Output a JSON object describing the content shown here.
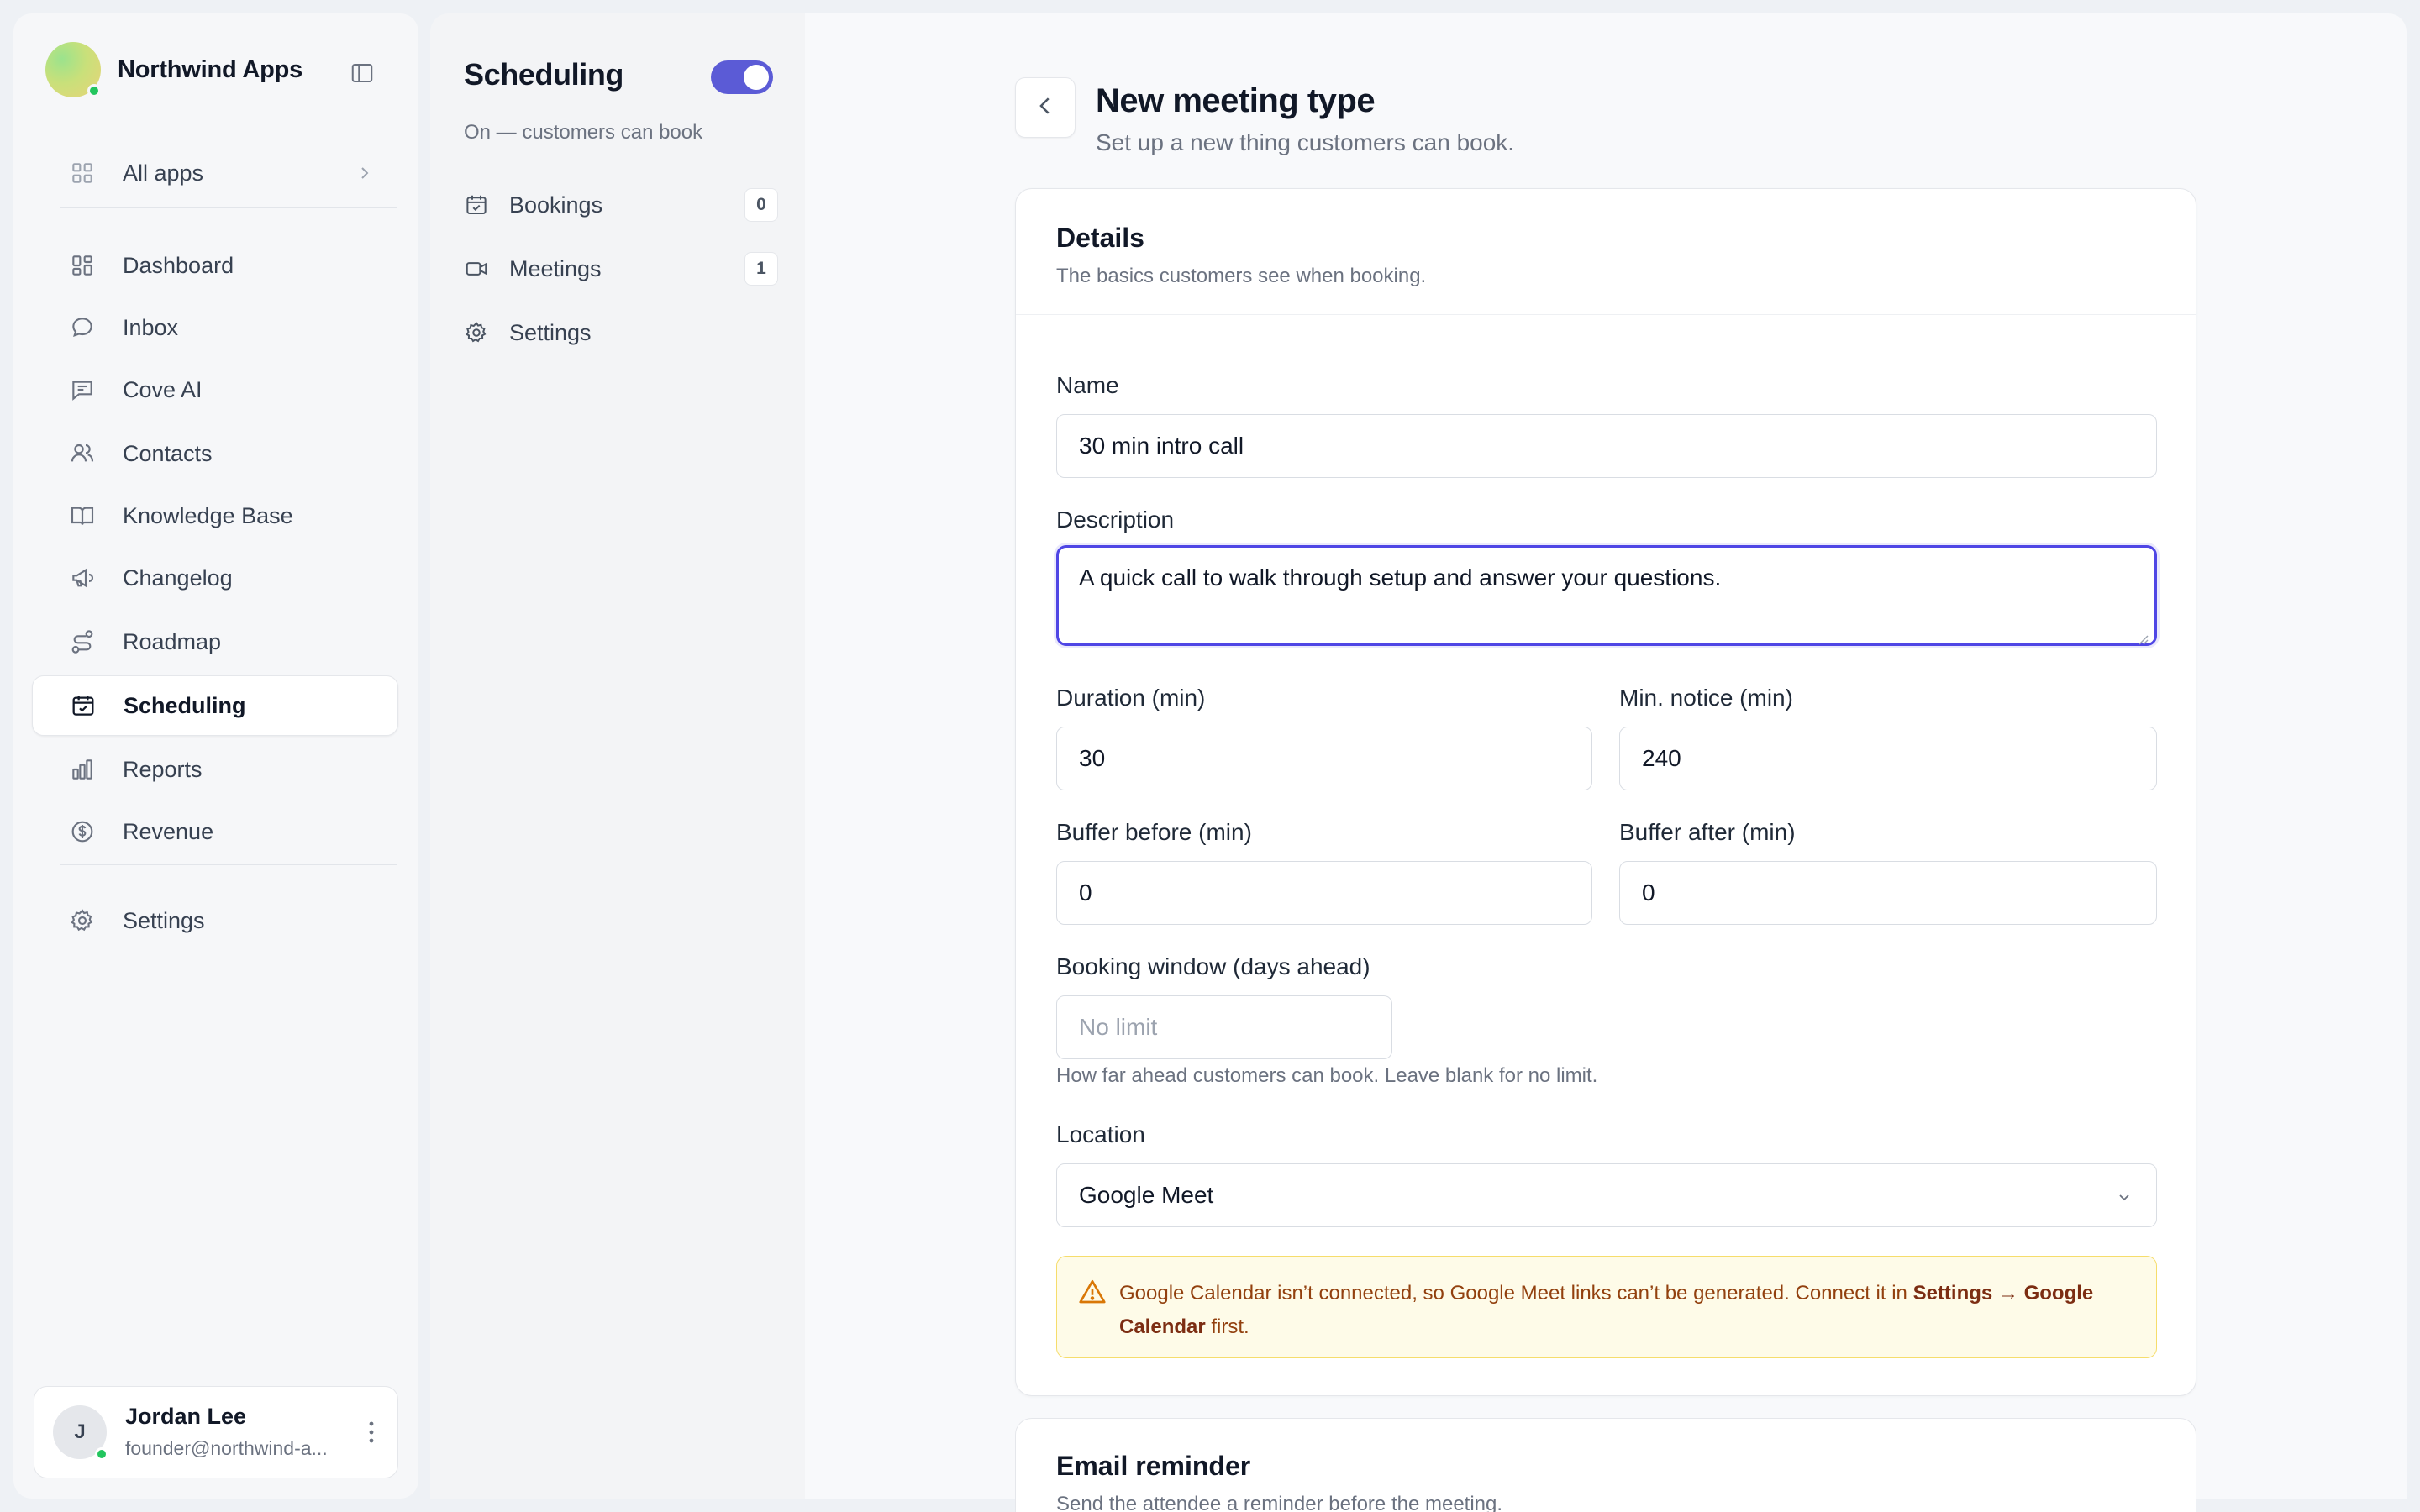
{
  "sidebar": {
    "brand": "Northwind Apps",
    "all_apps": "All apps",
    "items": [
      {
        "label": "Dashboard"
      },
      {
        "label": "Inbox"
      },
      {
        "label": "Cove AI"
      },
      {
        "label": "Contacts"
      },
      {
        "label": "Knowledge Base"
      },
      {
        "label": "Changelog"
      },
      {
        "label": "Roadmap"
      },
      {
        "label": "Scheduling",
        "active": true
      },
      {
        "label": "Reports"
      },
      {
        "label": "Revenue"
      }
    ],
    "settings": "Settings",
    "user": {
      "initial": "J",
      "name": "Jordan Lee",
      "email": "founder@northwind-a..."
    }
  },
  "subnav": {
    "title": "Scheduling",
    "toggle_on": true,
    "status": "On — customers can book",
    "items": [
      {
        "label": "Bookings",
        "count": "0"
      },
      {
        "label": "Meetings",
        "count": "1"
      },
      {
        "label": "Settings"
      }
    ]
  },
  "page": {
    "title": "New meeting type",
    "subtitle": "Set up a new thing customers can book."
  },
  "details": {
    "title": "Details",
    "subtitle": "The basics customers see when booking.",
    "name_label": "Name",
    "name_value": "30 min intro call",
    "description_label": "Description",
    "description_value": "A quick call to walk through setup and answer your questions.",
    "duration_label": "Duration (min)",
    "duration_value": "30",
    "notice_label": "Min. notice (min)",
    "notice_value": "240",
    "buffer_before_label": "Buffer before (min)",
    "buffer_before_value": "0",
    "buffer_after_label": "Buffer after (min)",
    "buffer_after_value": "0",
    "window_label": "Booking window (days ahead)",
    "window_placeholder": "No limit",
    "window_help": "How far ahead customers can book. Leave blank for no limit.",
    "location_label": "Location",
    "location_value": "Google Meet",
    "alert_text": "Google Calendar isn’t connected, so Google Meet links can’t be generated. Connect it in ",
    "alert_link": "Settings → Google Calendar",
    "alert_tail": " first."
  },
  "email_reminder": {
    "title": "Email reminder",
    "subtitle": "Send the attendee a reminder before the meeting."
  },
  "colors": {
    "accent": "#5b5bd6",
    "focus": "#4f46e5",
    "warning_bg": "#fefbe8",
    "warning_text": "#92400e",
    "online": "#22c55e"
  }
}
